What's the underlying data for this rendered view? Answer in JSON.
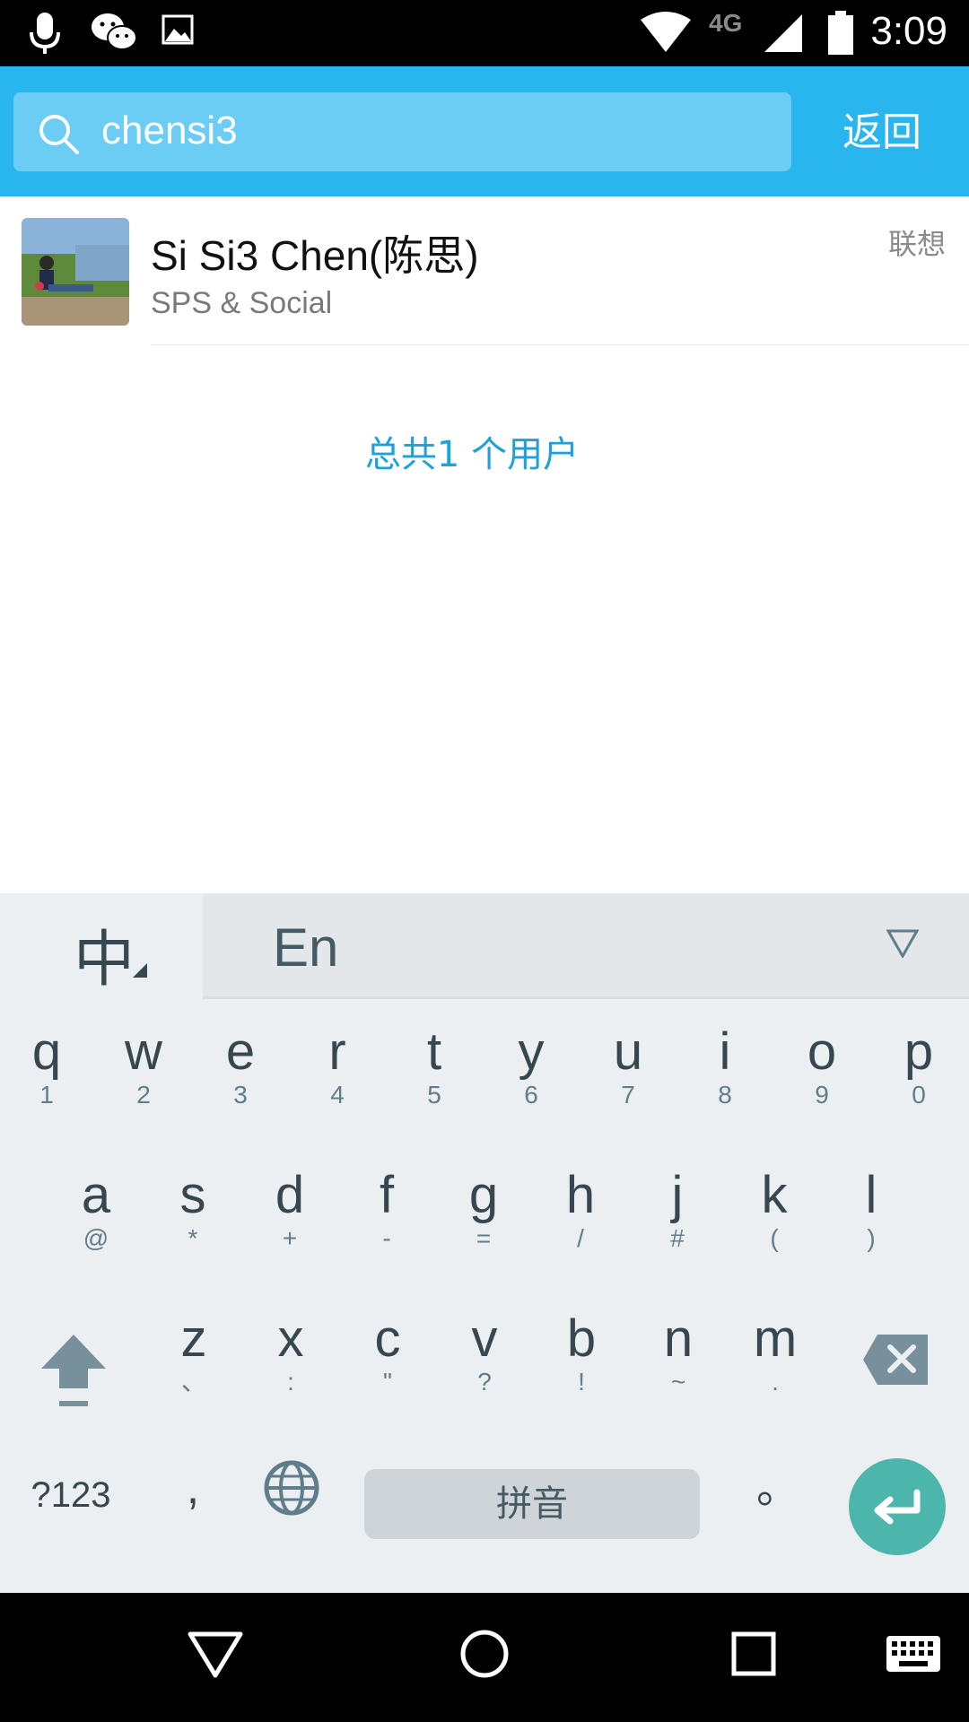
{
  "status_bar": {
    "time": "3:09",
    "network": "4G",
    "icons": [
      "microphone-icon",
      "wechat-icon",
      "image-icon",
      "wifi-icon",
      "signal-icon",
      "battery-icon"
    ]
  },
  "search": {
    "value": "chensi3",
    "back_label": "返回"
  },
  "results": [
    {
      "name": "Si Si3 Chen(陈思)",
      "department": "SPS & Social",
      "tag": "联想"
    }
  ],
  "summary": "总共1 个用户",
  "keyboard": {
    "lang_cn": "中",
    "lang_en": "En",
    "row1": [
      {
        "key": "q",
        "sub": "1"
      },
      {
        "key": "w",
        "sub": "2"
      },
      {
        "key": "e",
        "sub": "3"
      },
      {
        "key": "r",
        "sub": "4"
      },
      {
        "key": "t",
        "sub": "5"
      },
      {
        "key": "y",
        "sub": "6"
      },
      {
        "key": "u",
        "sub": "7"
      },
      {
        "key": "i",
        "sub": "8"
      },
      {
        "key": "o",
        "sub": "9"
      },
      {
        "key": "p",
        "sub": "0"
      }
    ],
    "row2": [
      {
        "key": "a",
        "sub": "@"
      },
      {
        "key": "s",
        "sub": "*"
      },
      {
        "key": "d",
        "sub": "+"
      },
      {
        "key": "f",
        "sub": "-"
      },
      {
        "key": "g",
        "sub": "="
      },
      {
        "key": "h",
        "sub": "/"
      },
      {
        "key": "j",
        "sub": "#"
      },
      {
        "key": "k",
        "sub": "("
      },
      {
        "key": "l",
        "sub": ")"
      }
    ],
    "row3": [
      {
        "key": "z",
        "sub": "、"
      },
      {
        "key": "x",
        "sub": ":"
      },
      {
        "key": "c",
        "sub": "\""
      },
      {
        "key": "v",
        "sub": "?"
      },
      {
        "key": "b",
        "sub": "!"
      },
      {
        "key": "n",
        "sub": "~"
      },
      {
        "key": "m",
        "sub": "."
      }
    ],
    "symbols_label": "?123",
    "comma": ",",
    "space_label": "拼音",
    "period": "。"
  },
  "colors": {
    "header": "#29b6ee",
    "search_box": "#6ccdf4",
    "summary_text": "#1fa0d8",
    "enter_key": "#4db6ac",
    "keyboard_bg": "#eceff1"
  }
}
